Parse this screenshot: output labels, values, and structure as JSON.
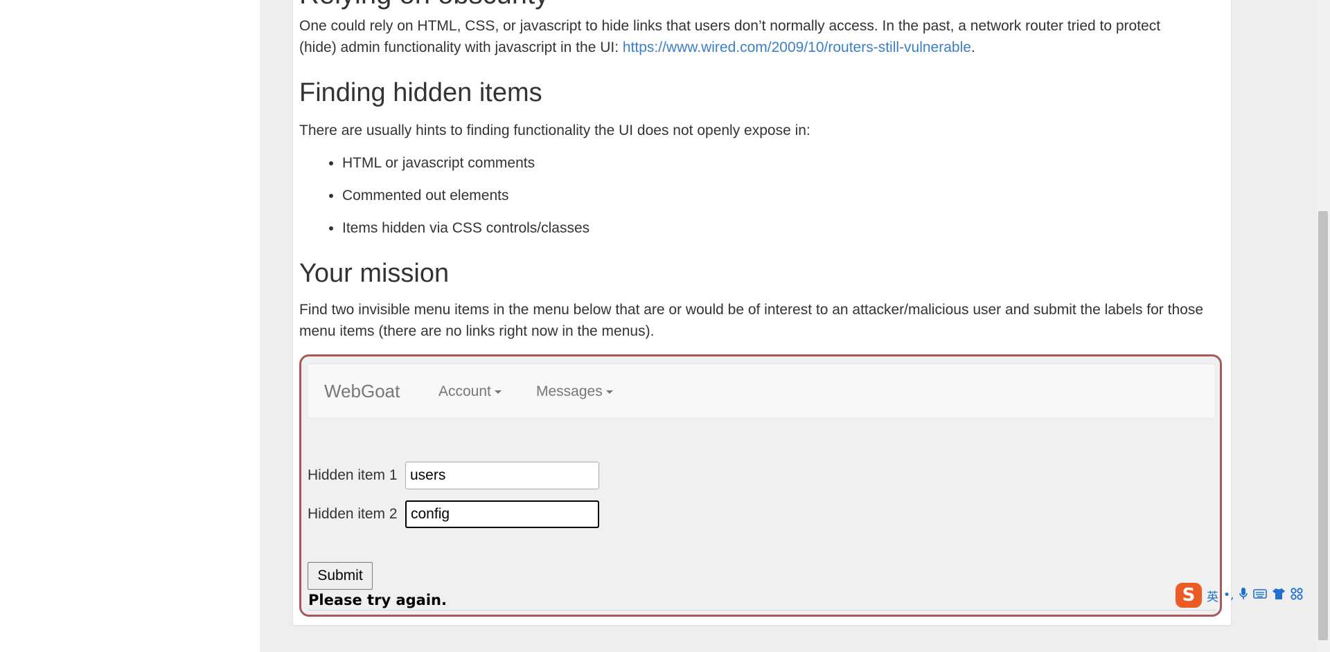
{
  "intro": {
    "heading_partial": "Relying on obscurity",
    "text": "One could rely on HTML, CSS, or javascript to hide links that users don’t normally access. In the past, a network router tried to protect (hide) admin functionality with javascript in the UI: ",
    "link_text": "https://www.wired.com/2009/10/routers-still-vulnerable",
    "text_end": "."
  },
  "finding": {
    "heading": "Finding hidden items",
    "text": "There are usually hints to finding functionality the UI does not openly expose in:",
    "hints": [
      "HTML or javascript comments",
      "Commented out elements",
      "Items hidden via CSS controls/classes"
    ]
  },
  "mission": {
    "heading": "Your mission",
    "text": "Find two invisible menu items in the menu below that are or would be of interest to an attacker/malicious user and submit the labels for those menu items (there are no links right now in the menus)."
  },
  "lesson": {
    "brand": "WebGoat",
    "menus": [
      "Account",
      "Messages"
    ],
    "field1_label": "Hidden item 1",
    "field1_value": "users",
    "field2_label": "Hidden item 2",
    "field2_value": "config",
    "submit_label": "Submit",
    "feedback": "Please try again."
  },
  "ime": {
    "logo": "S",
    "lang": "英",
    "punct": "•,",
    "icons": [
      "microphone-icon",
      "keyboard-icon",
      "skin-icon",
      "toolbox-icon"
    ]
  },
  "colors": {
    "link": "#3b7fc4",
    "lesson_border": "#a85a5a",
    "ime_orange": "#ec5b24",
    "ime_blue": "#1f6fd1"
  }
}
